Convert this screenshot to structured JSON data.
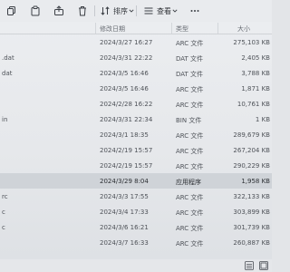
{
  "toolbar": {
    "sort_label": "排序",
    "view_label": "查看"
  },
  "columns": {
    "date": "修改日期",
    "type": "类型",
    "size": "大小"
  },
  "files": [
    {
      "name": "",
      "date": "2024/3/27 16:27",
      "type": "ARC 文件",
      "size": "275,103 KB"
    },
    {
      "name": ".dat",
      "date": "2024/3/31 22:22",
      "type": "DAT 文件",
      "size": "2,405 KB"
    },
    {
      "name": "dat",
      "date": "2024/3/5 16:46",
      "type": "DAT 文件",
      "size": "3,788 KB"
    },
    {
      "name": "",
      "date": "2024/3/5 16:46",
      "type": "ARC 文件",
      "size": "1,871 KB"
    },
    {
      "name": "",
      "date": "2024/2/28 16:22",
      "type": "ARC 文件",
      "size": "10,761 KB"
    },
    {
      "name": "in",
      "date": "2024/3/31 22:34",
      "type": "BIN 文件",
      "size": "1 KB"
    },
    {
      "name": "",
      "date": "2024/3/1 18:35",
      "type": "ARC 文件",
      "size": "289,679 KB"
    },
    {
      "name": "",
      "date": "2024/2/19 15:57",
      "type": "ARC 文件",
      "size": "267,204 KB"
    },
    {
      "name": "",
      "date": "2024/2/19 15:57",
      "type": "ARC 文件",
      "size": "290,229 KB"
    },
    {
      "name": "",
      "date": "2024/3/29 8:04",
      "type": "应用程序",
      "size": "1,958 KB",
      "selected": true
    },
    {
      "name": "rc",
      "date": "2024/3/3 17:55",
      "type": "ARC 文件",
      "size": "322,133 KB"
    },
    {
      "name": "c",
      "date": "2024/3/4 17:33",
      "type": "ARC 文件",
      "size": "303,899 KB"
    },
    {
      "name": "c",
      "date": "2024/3/6 16:21",
      "type": "ARC 文件",
      "size": "301,739 KB"
    },
    {
      "name": "",
      "date": "2024/3/7 16:33",
      "type": "ARC 文件",
      "size": "260,887 KB"
    }
  ],
  "icons": {
    "copy": "copy-icon",
    "paste": "paste-icon",
    "share": "share-icon",
    "delete": "trash-icon",
    "sort": "sort-icon",
    "view": "view-icon",
    "more": "more-icon"
  },
  "colors": {
    "background": "#e6e8eb",
    "selected_row": "#cfd3d8"
  }
}
